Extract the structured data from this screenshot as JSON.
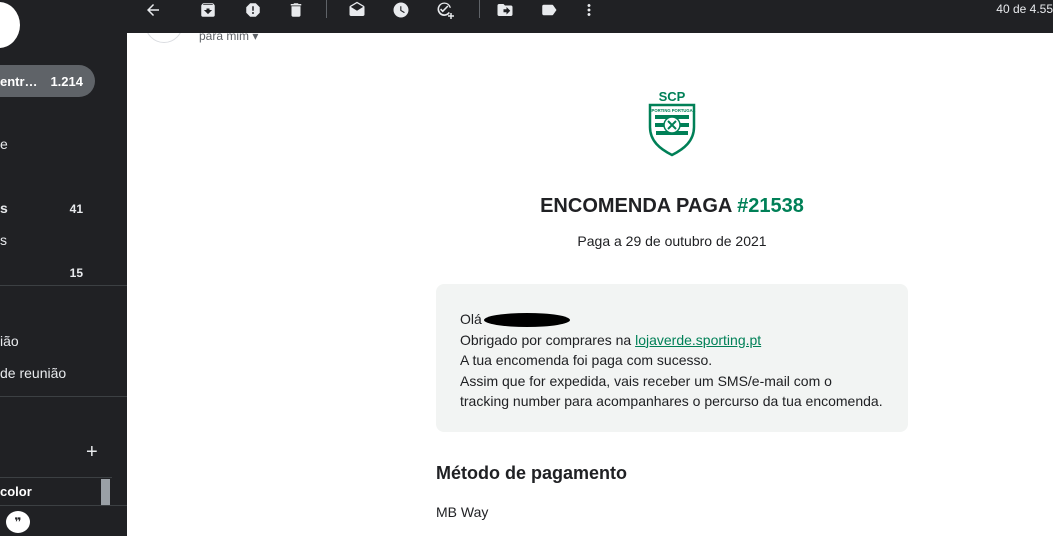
{
  "sidebar": {
    "active_item": {
      "label": "entr…",
      "count": "1.214"
    },
    "items": [
      {
        "label": "e",
        "count": ""
      },
      {
        "label": "s",
        "count": "41"
      },
      {
        "label": "s",
        "count": ""
      },
      {
        "label": "",
        "count": "15"
      },
      {
        "label": "ião",
        "count": ""
      },
      {
        "label": " de reunião",
        "count": ""
      }
    ],
    "add_label": "+",
    "label_row": "color"
  },
  "toolbar": {
    "buttons": [
      "back-arrow-icon",
      "archive-icon",
      "report-spam-icon",
      "delete-icon",
      "mark-unread-icon",
      "snooze-icon",
      "add-to-tasks-icon",
      "move-to-icon",
      "label-icon",
      "more-icon"
    ],
    "page_count": "40 de 4.55"
  },
  "email": {
    "to_me": "para mim",
    "logo_text": "SCP",
    "logo_ring": "SPORTING PORTUGAL",
    "title_prefix": "ENCOMENDA PAGA ",
    "order_number": "#21538",
    "paid_date": "Paga a 29 de outubro de 2021",
    "greeting": "Olá",
    "thanks_prefix": "Obrigado por comprares na ",
    "shop_link": "lojaverde.sporting.pt",
    "line_paid": "A tua encomenda foi paga com sucesso.",
    "line_ship_1": "Assim que for expedida, vais receber um SMS/e-mail com o",
    "line_ship_2": "tracking number para acompanhares o percurso da tua encomenda.",
    "payment_heading": "Método de pagamento",
    "payment_value": "MB Way"
  },
  "colors": {
    "sidebar_bg": "#202124",
    "brand_green": "#008057",
    "message_bg": "#f2f4f3"
  }
}
